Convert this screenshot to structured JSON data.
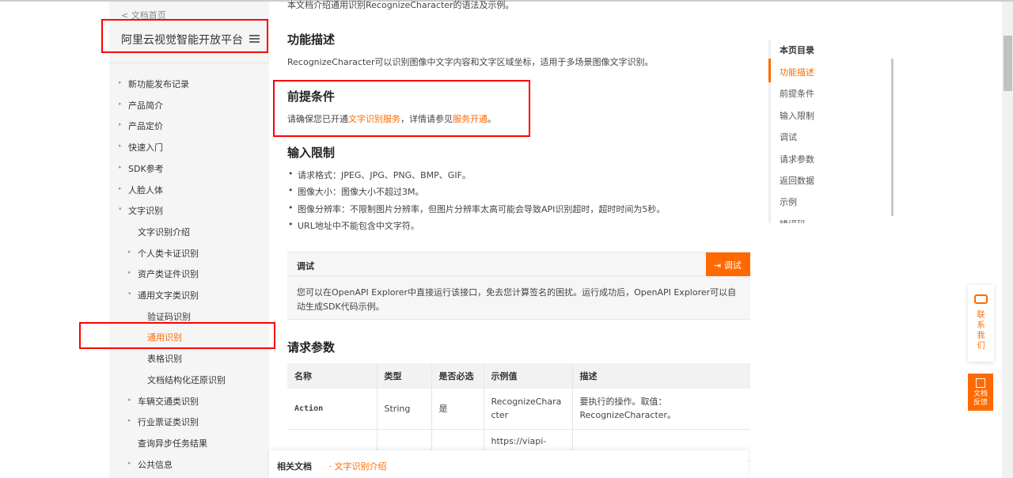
{
  "sidebar": {
    "back": "< 文档首页",
    "brand": "阿里云视觉智能开放平台",
    "items": [
      {
        "label": "新功能发布记录",
        "level": 1,
        "arrow": "▸"
      },
      {
        "label": "产品简介",
        "level": 1,
        "arrow": "▸"
      },
      {
        "label": "产品定价",
        "level": 1,
        "arrow": "▸"
      },
      {
        "label": "快速入门",
        "level": 1,
        "arrow": "▸"
      },
      {
        "label": "SDK参考",
        "level": 1,
        "arrow": "▸"
      },
      {
        "label": "人脸人体",
        "level": 1,
        "arrow": "▸"
      },
      {
        "label": "文字识别",
        "level": 1,
        "arrow": "▾"
      },
      {
        "label": "文字识别介绍",
        "level": 2,
        "arrow": ""
      },
      {
        "label": "个人类卡证识别",
        "level": 2,
        "arrow": "▸"
      },
      {
        "label": "资产类证件识别",
        "level": 2,
        "arrow": "▸"
      },
      {
        "label": "通用文字类识别",
        "level": 2,
        "arrow": "▾"
      },
      {
        "label": "验证码识别",
        "level": 3,
        "arrow": ""
      },
      {
        "label": "通用识别",
        "level": 3,
        "arrow": "",
        "selected": true
      },
      {
        "label": "表格识别",
        "level": 3,
        "arrow": ""
      },
      {
        "label": "文档结构化还原识别",
        "level": 3,
        "arrow": ""
      },
      {
        "label": "车辆交通类识别",
        "level": 2,
        "arrow": "▸"
      },
      {
        "label": "行业票证类识别",
        "level": 2,
        "arrow": "▸"
      },
      {
        "label": "查询异步任务结果",
        "level": 2,
        "arrow": ""
      },
      {
        "label": "公共信息",
        "level": 2,
        "arrow": "▸"
      }
    ]
  },
  "main": {
    "intro": "本文档介绍通用识别RecognizeCharacter的语法及示例。",
    "h_func": "功能描述",
    "func_text": "RecognizeCharacter可以识别图像中文字内容和文字区域坐标，适用于多场景图像文字识别。",
    "h_pre": "前提条件",
    "pre_1": "请确保您已开通",
    "pre_link1": "文字识别服务",
    "pre_2": "，详情请参见",
    "pre_link2": "服务开通",
    "pre_3": "。",
    "h_input": "输入限制",
    "input_items": [
      "请求格式：JPEG、JPG、PNG、BMP、GIF。",
      "图像大小：图像大小不超过3M。",
      "图像分辨率：不限制图片分辨率，但图片分辨率太高可能会导致API识别超时，超时时间为5秒。",
      "URL地址中不能包含中文字符。"
    ],
    "debug": {
      "title": "调试",
      "button": "调试",
      "body": "您可以在OpenAPI Explorer中直接运行该接口，免去您计算签名的困扰。运行成功后，OpenAPI Explorer可以自动生成SDK代码示例。"
    },
    "h_params": "请求参数",
    "table": {
      "headers": [
        "名称",
        "类型",
        "是否必选",
        "示例值",
        "描述"
      ],
      "rows": [
        [
          "Action",
          "String",
          "是",
          "RecognizeCharacter",
          "要执行的操作。取值：RecognizeCharacter。"
        ],
        [
          "",
          "",
          "",
          "https://viapi-",
          ""
        ]
      ]
    },
    "related": {
      "label": "相关文档",
      "link": "文字识别介绍"
    }
  },
  "toc": {
    "title": "本页目录",
    "items": [
      "功能描述",
      "前提条件",
      "输入限制",
      "调试",
      "请求参数",
      "返回数据",
      "示例",
      "错误码"
    ]
  },
  "float": {
    "contact": "联系我们",
    "feedback": "文档反馈"
  },
  "colors": {
    "accent": "#ff6a00",
    "annotation": "#ff0000"
  }
}
